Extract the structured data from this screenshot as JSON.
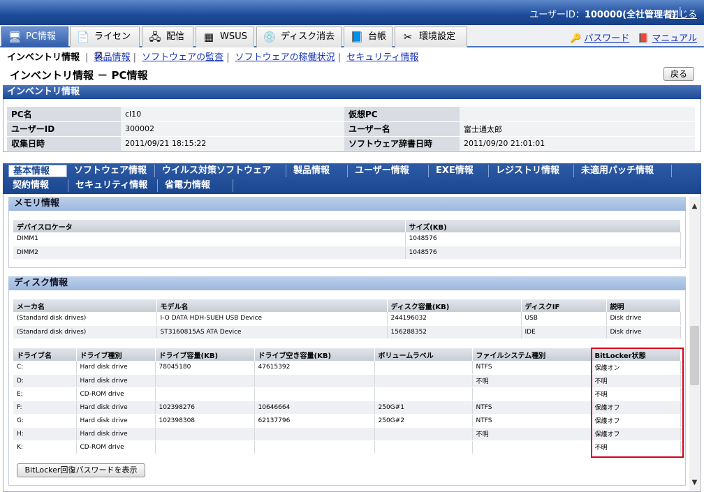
{
  "topbar": {
    "user_label": "ユーザーID：",
    "user_id": "100000(全社管理者)",
    "logout": "閉じる"
  },
  "main_tabs": [
    {
      "label": "PC情報",
      "icon": "pc-icon",
      "glyph": "🖥"
    },
    {
      "label": "ライセンス",
      "icon": "license-icon",
      "glyph": "📄"
    },
    {
      "label": "配信",
      "icon": "distribution-icon",
      "glyph": "🖧"
    },
    {
      "label": "WSUS",
      "icon": "wsus-icon",
      "glyph": "▦"
    },
    {
      "label": "ディスク消去",
      "icon": "disk-erase-icon",
      "glyph": "💿"
    },
    {
      "label": "台帳",
      "icon": "ledger-icon",
      "glyph": "📘"
    },
    {
      "label": "環境設定",
      "icon": "settings-icon",
      "glyph": "✂"
    }
  ],
  "right_links": {
    "password": "パスワード",
    "manual": "マニュアル"
  },
  "subnav": {
    "current": "インベントリ情報",
    "links": [
      "製品情報",
      "ソフトウェアの監査",
      "ソフトウェアの稼働状況",
      "セキュリティ情報"
    ]
  },
  "page": {
    "title": "インベントリ情報 － PC情報",
    "back": "戻る",
    "section": "インベントリ情報"
  },
  "info": {
    "pc_name_label": "PC名",
    "pc_name": "cl10",
    "virtual_label": "仮想PC",
    "virtual": "",
    "user_id_label": "ユーザーID",
    "user_id": "300002",
    "user_name_label": "ユーザー名",
    "user_name": "富士通太郎",
    "collected_label": "収集日時",
    "collected": "2011/09/21 18:15:22",
    "dict_label": "ソフトウェア辞書日時",
    "dict": "2011/09/20 21:01:01"
  },
  "detail_tabs_row1": [
    "基本情報",
    "ソフトウェア情報",
    "ウイルス対策ソフトウェア",
    "製品情報",
    "ユーザー情報",
    "EXE情報",
    "レジストリ情報",
    "未適用パッチ情報"
  ],
  "detail_tabs_row2": [
    "契約情報",
    "セキュリティ情報",
    "省電力情報"
  ],
  "memory": {
    "title": "メモリ情報",
    "headers": [
      "デバイスロケータ",
      "サイズ(KB)"
    ],
    "rows": [
      [
        "DIMM1",
        "1048576"
      ],
      [
        "DIMM2",
        "1048576"
      ]
    ]
  },
  "disk": {
    "title": "ディスク情報",
    "headers": [
      "メーカ名",
      "モデル名",
      "ディスク容量(KB)",
      "ディスクIF",
      "説明"
    ],
    "rows": [
      [
        "(Standard disk drives)",
        "I-O DATA HDH-SUEH USB Device",
        "244196032",
        "USB",
        "Disk drive"
      ],
      [
        "(Standard disk drives)",
        "ST3160815AS ATA Device",
        "156288352",
        "IDE",
        "Disk drive"
      ]
    ],
    "drive_headers": [
      "ドライブ名",
      "ドライブ種別",
      "ドライブ容量(KB)",
      "ドライブ空き容量(KB)",
      "ボリュームラベル",
      "ファイルシステム種別",
      "BitLocker状態"
    ],
    "drive_rows": [
      [
        "C:",
        "Hard disk drive",
        "78045180",
        "47615392",
        "",
        "NTFS",
        "保護オン"
      ],
      [
        "D:",
        "Hard disk drive",
        "",
        "",
        "",
        "不明",
        "不明"
      ],
      [
        "E:",
        "CD-ROM drive",
        "",
        "",
        "",
        "",
        "不明"
      ],
      [
        "F:",
        "Hard disk drive",
        "102398276",
        "10646664",
        "250G#1",
        "NTFS",
        "保護オフ"
      ],
      [
        "G:",
        "Hard disk drive",
        "102398308",
        "62137796",
        "250G#2",
        "NTFS",
        "保護オフ"
      ],
      [
        "H:",
        "Hard disk drive",
        "",
        "",
        "",
        "不明",
        "保護オフ"
      ],
      [
        "K:",
        "CD-ROM drive",
        "",
        "",
        "",
        "",
        "不明"
      ]
    ],
    "bitlocker_button": "BitLocker回復パスワードを表示"
  }
}
